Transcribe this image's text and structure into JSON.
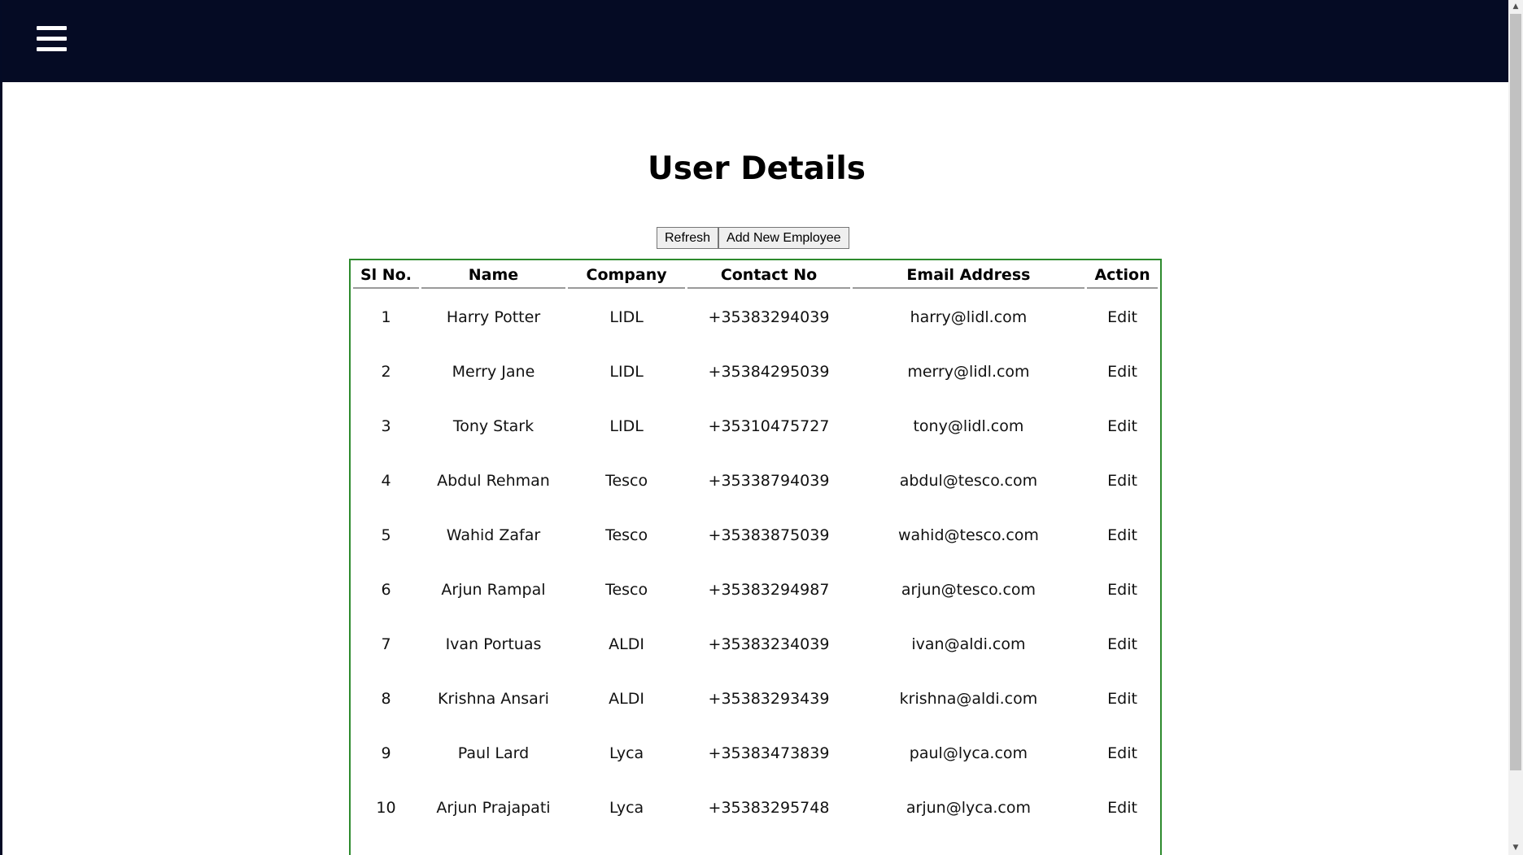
{
  "navbar": {
    "menu_icon": "hamburger-menu-icon",
    "background_color": "#050b24"
  },
  "page": {
    "title": "User Details"
  },
  "toolbar": {
    "refresh_label": "Refresh",
    "add_label": "Add New Employee"
  },
  "table": {
    "border_color": "#2e8b2e",
    "headers": {
      "sl": "Sl No.",
      "name": "Name",
      "company": "Company",
      "contact": "Contact No",
      "email": "Email Address",
      "action": "Action"
    },
    "rows": [
      {
        "sl": "1",
        "name": "Harry Potter",
        "company": "LIDL",
        "contact": "+35383294039",
        "email": "harry@lidl.com",
        "action": "Edit"
      },
      {
        "sl": "2",
        "name": "Merry Jane",
        "company": "LIDL",
        "contact": "+35384295039",
        "email": "merry@lidl.com",
        "action": "Edit"
      },
      {
        "sl": "3",
        "name": "Tony Stark",
        "company": "LIDL",
        "contact": "+35310475727",
        "email": "tony@lidl.com",
        "action": "Edit"
      },
      {
        "sl": "4",
        "name": "Abdul Rehman",
        "company": "Tesco",
        "contact": "+35338794039",
        "email": "abdul@tesco.com",
        "action": "Edit"
      },
      {
        "sl": "5",
        "name": "Wahid Zafar",
        "company": "Tesco",
        "contact": "+35383875039",
        "email": "wahid@tesco.com",
        "action": "Edit"
      },
      {
        "sl": "6",
        "name": "Arjun Rampal",
        "company": "Tesco",
        "contact": "+35383294987",
        "email": "arjun@tesco.com",
        "action": "Edit"
      },
      {
        "sl": "7",
        "name": "Ivan Portuas",
        "company": "ALDI",
        "contact": "+35383234039",
        "email": "ivan@aldi.com",
        "action": "Edit"
      },
      {
        "sl": "8",
        "name": "Krishna Ansari",
        "company": "ALDI",
        "contact": "+35383293439",
        "email": "krishna@aldi.com",
        "action": "Edit"
      },
      {
        "sl": "9",
        "name": "Paul Lard",
        "company": "Lyca",
        "contact": "+35383473839",
        "email": "paul@lyca.com",
        "action": "Edit"
      },
      {
        "sl": "10",
        "name": "Arjun Prajapati",
        "company": "Lyca",
        "contact": "+35383295748",
        "email": "arjun@lyca.com",
        "action": "Edit"
      }
    ]
  }
}
